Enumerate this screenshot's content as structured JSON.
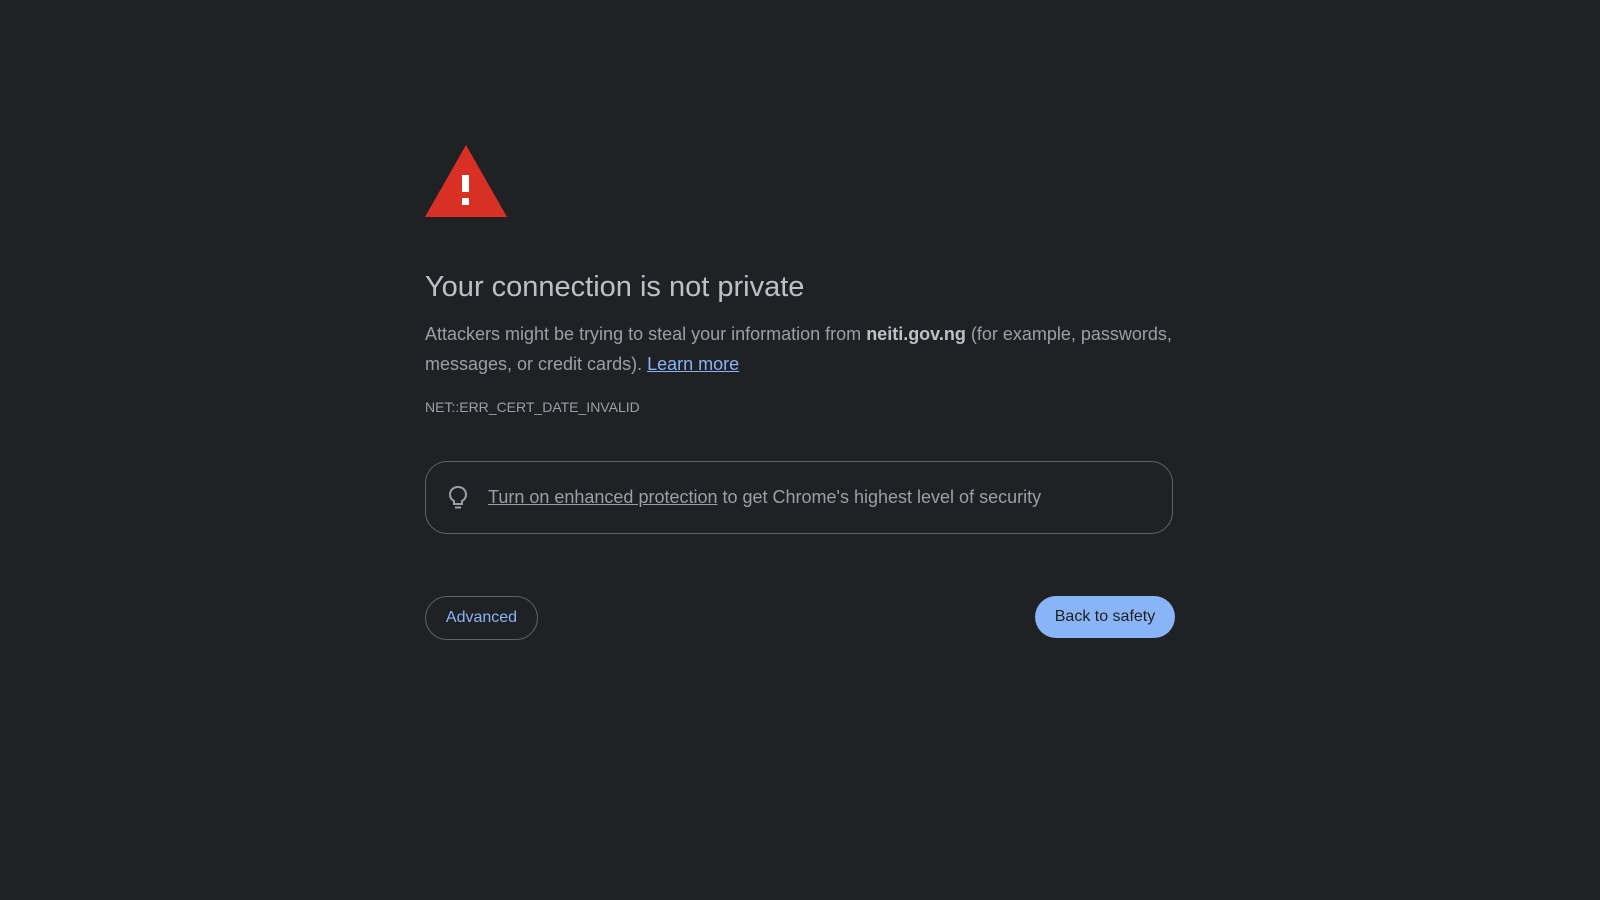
{
  "page": {
    "title": "Your connection is not private",
    "message_prefix": "Attackers might be trying to steal your information from ",
    "host": "neiti.gov.ng",
    "message_suffix": " (for example, passwords, messages, or credit cards). ",
    "learn_more": "Learn more",
    "error_code": "NET::ERR_CERT_DATE_INVALID"
  },
  "protection": {
    "icon": "lightbulb-icon",
    "link_text": "Turn on enhanced protection",
    "rest_text": " to get Chrome's highest level of security"
  },
  "buttons": {
    "advanced": "Advanced",
    "back_to_safety": "Back to safety"
  },
  "colors": {
    "background": "#202124",
    "warning": "#d93025",
    "link": "#8ab4f8",
    "primary_button": "#8ab4f8"
  }
}
